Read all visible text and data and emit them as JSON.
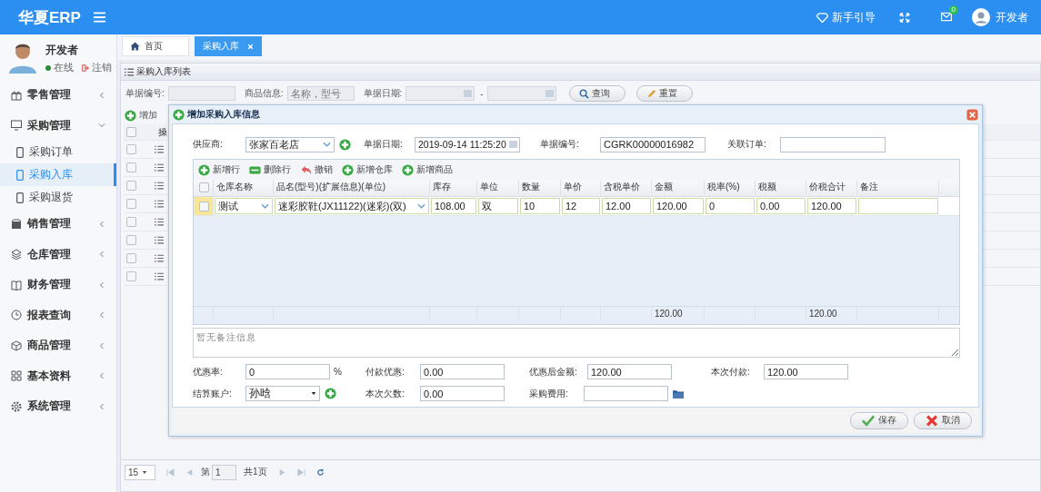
{
  "header": {
    "logo": "华夏ERP",
    "guide": "新手引导",
    "mail_badge": "0",
    "user": "开发者"
  },
  "sidebar": {
    "user": {
      "name": "开发者",
      "status": "在线",
      "logout": "注销"
    },
    "items": [
      {
        "label": "零售管理",
        "kind": "gift",
        "expanded": false
      },
      {
        "label": "采购管理",
        "kind": "screen",
        "expanded": true,
        "children": [
          {
            "label": "采购订单",
            "selected": false
          },
          {
            "label": "采购入库",
            "selected": true
          },
          {
            "label": "采购退货",
            "selected": false
          }
        ]
      },
      {
        "label": "销售管理",
        "kind": "box",
        "expanded": false
      },
      {
        "label": "仓库管理",
        "kind": "layers",
        "expanded": false
      },
      {
        "label": "财务管理",
        "kind": "book",
        "expanded": false
      },
      {
        "label": "报表查询",
        "kind": "clock",
        "expanded": false
      },
      {
        "label": "商品管理",
        "kind": "cube",
        "expanded": false
      },
      {
        "label": "基本资料",
        "kind": "grid",
        "expanded": false
      },
      {
        "label": "系统管理",
        "kind": "gear",
        "expanded": false
      }
    ]
  },
  "tabs": [
    {
      "label": "首页",
      "selected": false
    },
    {
      "label": "采购入库",
      "selected": true
    }
  ],
  "list_panel": {
    "title": "采购入库列表",
    "search": [
      {
        "label": "单据编号:"
      },
      {
        "label": "商品信息:",
        "placeholder": "名称，型号"
      },
      {
        "label": "单据日期:"
      }
    ],
    "date_separator": "-",
    "buttons": [
      "查询",
      "重置"
    ],
    "toolbar": [
      "增加"
    ],
    "column": "操",
    "all_selected": false,
    "rows": [
      {
        "selected": false
      },
      {
        "selected": false
      },
      {
        "selected": false
      },
      {
        "selected": false
      },
      {
        "selected": false
      },
      {
        "selected": false
      },
      {
        "selected": false
      },
      {
        "selected": false
      }
    ],
    "pager": {
      "page_size": "15",
      "page_label": "第",
      "page": "1",
      "total": "共1页"
    }
  },
  "dialog": {
    "title": "增加采购入库信息",
    "supplier": {
      "label": "供应商:",
      "value": "张家百老店"
    },
    "date": {
      "label": "单据日期:",
      "value": "2019-09-14 11:25:20"
    },
    "number": {
      "label": "单据编号:",
      "value": "CGRK00000016982"
    },
    "linked_order": {
      "label": "关联订单:"
    },
    "grid_toolbar": [
      {
        "label": "新增行",
        "kind": "add"
      },
      {
        "label": "删除行",
        "kind": "remove"
      },
      {
        "label": "撤销",
        "kind": "undo"
      },
      {
        "label": "新增仓库",
        "kind": "add"
      },
      {
        "label": "新增商品",
        "kind": "add"
      }
    ],
    "columns": [
      "仓库名称",
      "品名(型号)(扩展信息)(单位)",
      "库存",
      "单位",
      "数量",
      "单价",
      "含税单价",
      "金额",
      "税率(%)",
      "税额",
      "价税合计",
      "备注"
    ],
    "rows": [
      {
        "selected": false,
        "cells": [
          "测试",
          "迷彩胶鞋(JX11122)(迷彩)(双)",
          "108.00",
          "双",
          "10",
          "12",
          "12.00",
          "120.00",
          "0",
          "0.00",
          "120.00"
        ]
      }
    ],
    "totals": {
      "amount": "120.00",
      "total_with_tax": "120.00"
    },
    "all_selected": false,
    "remark": {
      "placeholder": "暂无备注信息"
    },
    "fields": [
      {
        "label": "优惠率:",
        "value": "0",
        "suffix": "%",
        "kind": "text"
      },
      {
        "label": "付款优惠:",
        "value": "0.00",
        "kind": "text"
      },
      {
        "label": "优惠后金额:",
        "value": "120.00",
        "kind": "text"
      },
      {
        "label": "本次付款:",
        "value": "120.00",
        "kind": "text"
      },
      {
        "label": "结算账户:",
        "value": "孙晗",
        "kind": "select"
      },
      {
        "label": "本次欠数:",
        "value": "0.00",
        "kind": "text"
      },
      {
        "label": "采购费用:",
        "kind": "folder"
      }
    ],
    "buttons": [
      {
        "label": "保存",
        "kind": "save"
      },
      {
        "label": "取消",
        "kind": "cancel"
      }
    ]
  }
}
